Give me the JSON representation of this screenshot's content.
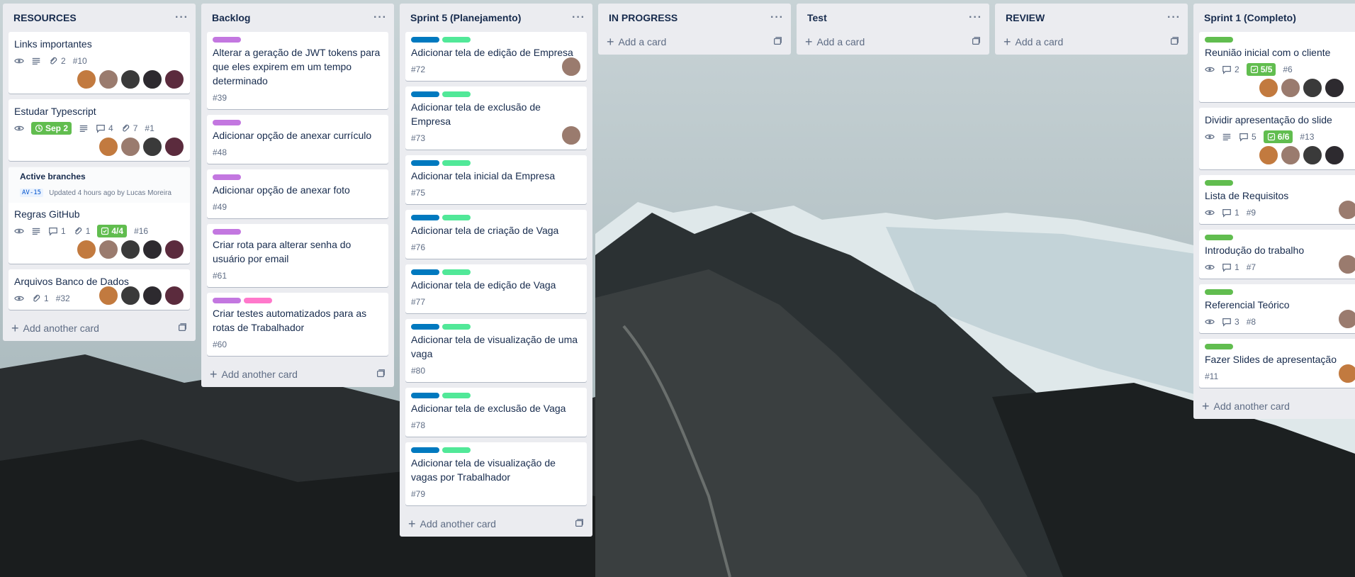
{
  "colors": {
    "label_purple": "#c377e0",
    "label_pink": "#ff78cb",
    "label_blue": "#0079bf",
    "label_teal": "#51e898",
    "label_green": "#61bd4f",
    "due_green": "#61bd4f"
  },
  "common": {
    "add_another_card": "Add another card",
    "add_a_card": "Add a card",
    "menu": "···"
  },
  "lists": [
    {
      "title": "RESOURCES",
      "cards": [
        {
          "title": "Links importantes",
          "attachments": "2",
          "num": "#10"
        },
        {
          "title": "Estudar Typescript",
          "due": "Sep 2",
          "comments": "4",
          "attachments": "7",
          "num": "#1"
        },
        {
          "branches_title": "Active branches",
          "branch": "AV-15",
          "branch_updated": "Updated 4 hours ago by Lucas Moreira",
          "title": "Regras GitHub",
          "comments": "1",
          "attachments": "1",
          "checklist": "4/4",
          "num": "#16"
        },
        {
          "title": "Arquivos Banco de Dados",
          "attachments": "1",
          "num": "#32"
        }
      ]
    },
    {
      "title": "Backlog",
      "cards": [
        {
          "title": "Alterar a geração de JWT tokens para que eles expirem em um tempo determinado",
          "num": "#39"
        },
        {
          "title": "Adicionar opção de anexar currículo",
          "num": "#48"
        },
        {
          "title": "Adicionar opção de anexar foto",
          "num": "#49"
        },
        {
          "title": "Criar rota para alterar senha do usuário por email",
          "num": "#61"
        },
        {
          "title": "Criar testes automatizados para as rotas de Trabalhador",
          "num": "#60"
        }
      ]
    },
    {
      "title": "Sprint 5 (Planejamento)",
      "cards": [
        {
          "title": "Adicionar tela de edição de Empresa",
          "num": "#72"
        },
        {
          "title": "Adicionar tela de exclusão de Empresa",
          "num": "#73"
        },
        {
          "title": "Adicionar tela inicial da Empresa",
          "num": "#75"
        },
        {
          "title": "Adicionar tela de criação de Vaga",
          "num": "#76"
        },
        {
          "title": "Adicionar tela de edição de Vaga",
          "num": "#77"
        },
        {
          "title": "Adicionar tela de visualização de uma vaga",
          "num": "#80"
        },
        {
          "title": "Adicionar tela de exclusão de Vaga",
          "num": "#78"
        },
        {
          "title": "Adicionar tela de visualização de vagas por Trabalhador",
          "num": "#79"
        }
      ]
    },
    {
      "title": "IN PROGRESS"
    },
    {
      "title": "Test"
    },
    {
      "title": "REVIEW"
    },
    {
      "title": "Sprint 1 (Completo)",
      "cards": [
        {
          "title": "Reunião inicial com o cliente",
          "comments": "2",
          "checklist": "5/5",
          "num": "#6"
        },
        {
          "title": "Dividir apresentação do slide",
          "comments": "5",
          "checklist": "6/6",
          "num": "#13"
        },
        {
          "title": "Lista de Requisitos",
          "comments": "1",
          "num": "#9"
        },
        {
          "title": "Introdução do trabalho",
          "comments": "1",
          "num": "#7"
        },
        {
          "title": "Referencial Teórico",
          "comments": "3",
          "num": "#8"
        },
        {
          "title": "Fazer Slides de apresentação",
          "num": "#11"
        }
      ]
    }
  ]
}
